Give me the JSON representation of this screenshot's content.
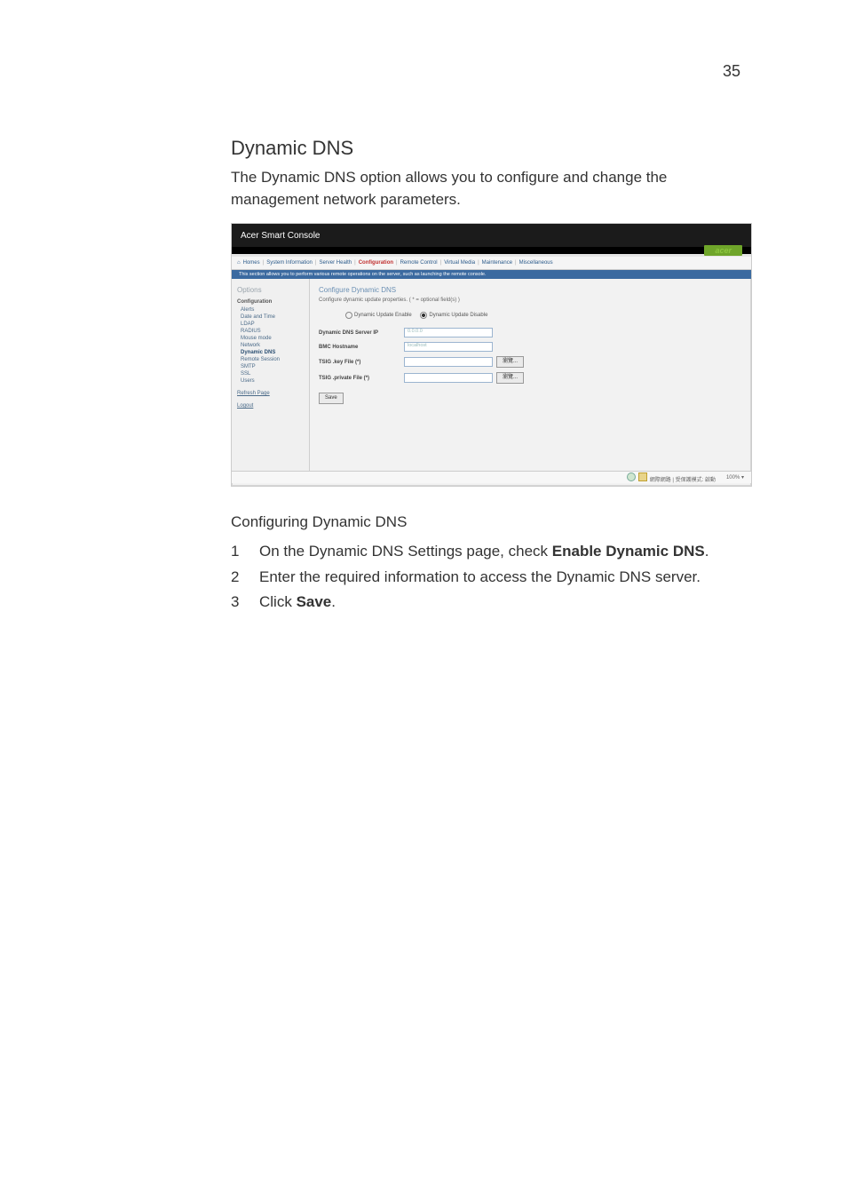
{
  "page_number": "35",
  "heading": "Dynamic DNS",
  "intro": "The Dynamic DNS option allows you to configure and change the management network parameters.",
  "subheading": "Configuring Dynamic DNS",
  "steps": [
    {
      "pre": "On the Dynamic DNS Settings page, check ",
      "bold": "Enable Dynamic DNS",
      "post": "."
    },
    {
      "pre": "Enter the required information to access the Dynamic DNS server.",
      "bold": "",
      "post": ""
    },
    {
      "pre": "Click ",
      "bold": "Save",
      "post": "."
    }
  ],
  "screenshot": {
    "window_title": "Acer Smart Console",
    "brand": "acer",
    "tabs": [
      "Homes",
      "System Information",
      "Server Health",
      "Configuration",
      "Remote Control",
      "Virtual Media",
      "Maintenance",
      "Miscellaneous"
    ],
    "banner": "This section allows you to perform various remote operations on the server, such as launching the remote console.",
    "side": {
      "head": "Options",
      "sub": "Configuration",
      "items": [
        "Alerts",
        "Date and Time",
        "LDAP",
        "RADIUS",
        "Mouse mode",
        "Network",
        "Dynamic DNS",
        "Remote Session",
        "SMTP",
        "SSL",
        "Users"
      ],
      "selected": "Dynamic DNS",
      "links": [
        "Refresh Page",
        "Logout"
      ]
    },
    "main": {
      "title": "Configure Dynamic DNS",
      "desc": "Configure dynamic update properties. ( * = optional field(s) )",
      "radio_enable": "Dynamic Update Enable",
      "radio_disable": "Dynamic Update Disable",
      "rows": [
        {
          "label": "Dynamic DNS Server IP",
          "ph": "0.0.0.0"
        },
        {
          "label": "BMC Hostname",
          "ph": "localhost"
        },
        {
          "label": "TSIG .key File (*)",
          "btn": "瀏覽..."
        },
        {
          "label": "TSIG .private File (*)",
          "btn": "瀏覽..."
        }
      ],
      "save": "Save"
    },
    "status": {
      "zone": "網際網路 | 受保護模式: 啟動",
      "zoom": "100%"
    }
  }
}
